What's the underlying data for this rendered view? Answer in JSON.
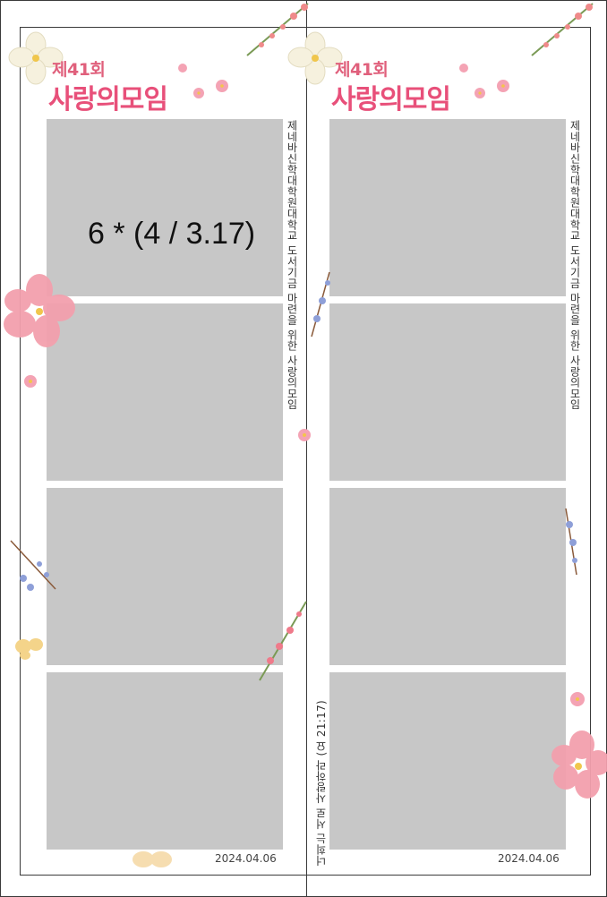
{
  "strips": [
    {
      "id": "left",
      "title_small": "제41회",
      "title_big": "사랑의모임",
      "side_text": "제네바신학대학원대학교 도서기금 마련을 위한 사랑의모임",
      "date": "2024.04.06",
      "overlay_note": "6 * (4 / 3.17)"
    },
    {
      "id": "right",
      "title_small": "제41회",
      "title_big": "사랑의모임",
      "side_text": "제네바신학대학원대학교 도서기금 마련을 위한 사랑의모임",
      "bottom_text": "너희는 서로 사랑하라 (요 21:17)",
      "date": "2024.04.06"
    }
  ],
  "colors": {
    "title": "#e8507a",
    "photo_placeholder": "#c7c7c7",
    "border": "#3a3a3a"
  }
}
